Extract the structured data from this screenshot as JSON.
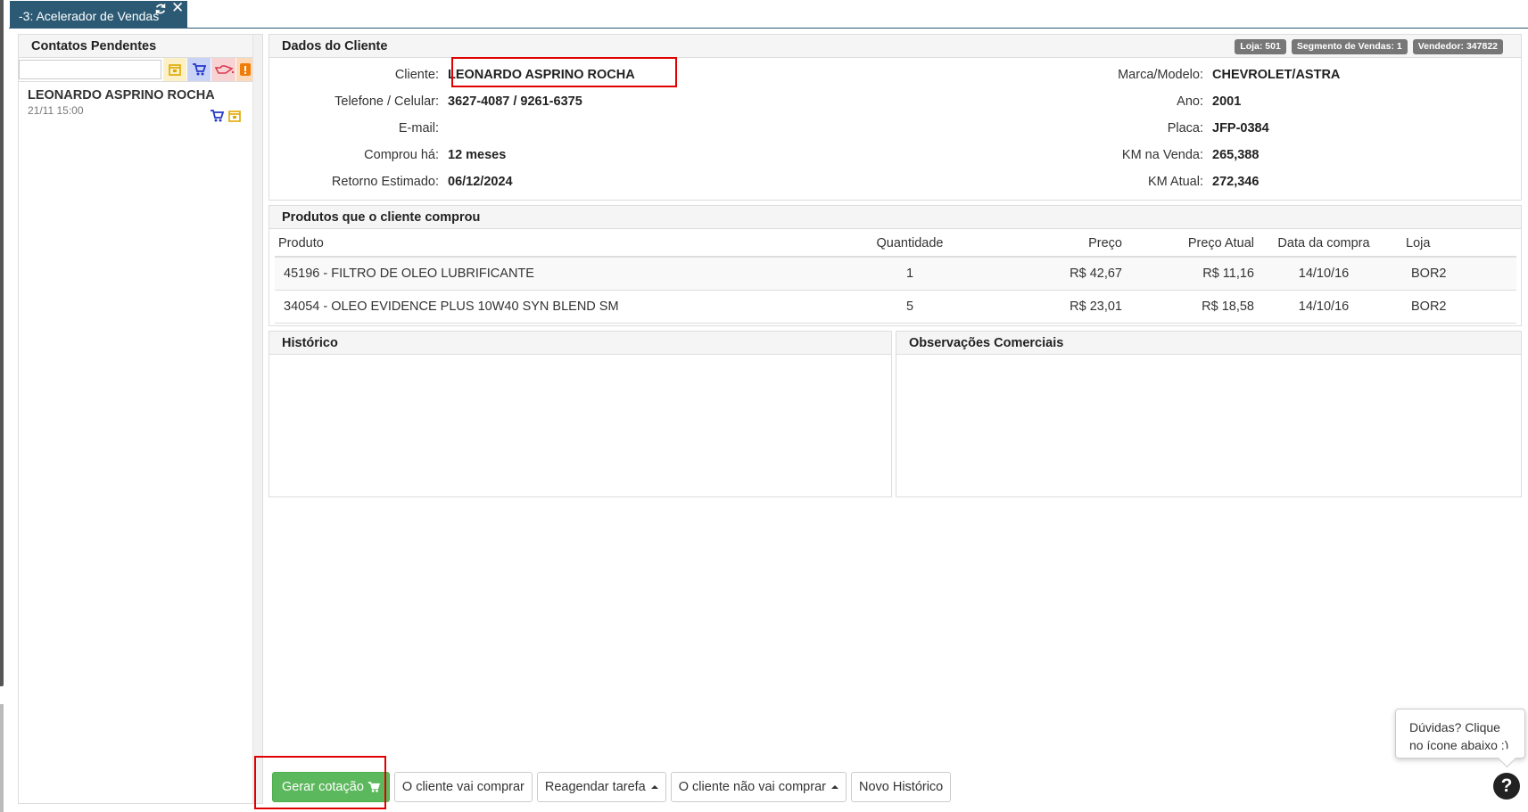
{
  "tab": {
    "title": "-3: Acelerador de Vendas"
  },
  "left": {
    "heading": "Contatos Pendentes",
    "search_placeholder": "",
    "contacts": [
      {
        "name": "LEONARDO ASPRINO ROCHA",
        "time": "21/11 15:00"
      }
    ]
  },
  "client": {
    "heading": "Dados do Cliente",
    "badges": {
      "loja": "Loja: 501",
      "segmento": "Segmento de Vendas: 1",
      "vendedor": "Vendedor: 347822"
    },
    "left_fields": [
      {
        "label": "Cliente:",
        "value": "LEONARDO ASPRINO ROCHA"
      },
      {
        "label": "Telefone / Celular:",
        "value": "3627-4087 / 9261-6375"
      },
      {
        "label": "E-mail:",
        "value": ""
      },
      {
        "label": "Comprou há:",
        "value": "12 meses"
      },
      {
        "label": "Retorno Estimado:",
        "value": "06/12/2024"
      }
    ],
    "right_fields": [
      {
        "label": "Marca/Modelo:",
        "value": "CHEVROLET/ASTRA"
      },
      {
        "label": "Ano:",
        "value": "2001"
      },
      {
        "label": "Placa:",
        "value": "JFP-0384"
      },
      {
        "label": "KM na Venda:",
        "value": "265,388"
      },
      {
        "label": "KM Atual:",
        "value": "272,346"
      }
    ]
  },
  "products": {
    "heading": "Produtos que o cliente comprou",
    "columns": [
      "Produto",
      "Quantidade",
      "Preço",
      "Preço Atual",
      "Data da compra",
      "Loja"
    ],
    "rows": [
      [
        "45196 - FILTRO DE OLEO LUBRIFICANTE",
        "1",
        "R$ 42,67",
        "R$ 11,16",
        "14/10/16",
        "BOR2"
      ],
      [
        "34054 - OLEO EVIDENCE PLUS 10W40 SYN BLEND SM",
        "5",
        "R$ 23,01",
        "R$ 18,58",
        "14/10/16",
        "BOR2"
      ]
    ]
  },
  "history": {
    "heading": "Histórico"
  },
  "observations": {
    "heading": "Observações Comerciais"
  },
  "actions": {
    "generate": "Gerar cotação",
    "will_buy": "O cliente vai comprar",
    "reschedule": "Reagendar tarefa",
    "wont_buy": "O cliente não vai comprar",
    "new_history": "Novo Histórico"
  },
  "help": {
    "line1": "Dúvidas? Clique",
    "line2": "no ícone abaixo :)",
    "icon_char": "?"
  },
  "colors": {
    "tab": "#2c5a74",
    "success": "#5cb85c",
    "highlight": "#e00000",
    "badge": "#777777"
  },
  "icons": {
    "refresh": "refresh-icon",
    "close": "close-icon",
    "calendar": "calendar-icon",
    "cart": "cart-icon",
    "oil": "oil-can-icon",
    "alert": "alert-icon",
    "help": "help-icon"
  }
}
